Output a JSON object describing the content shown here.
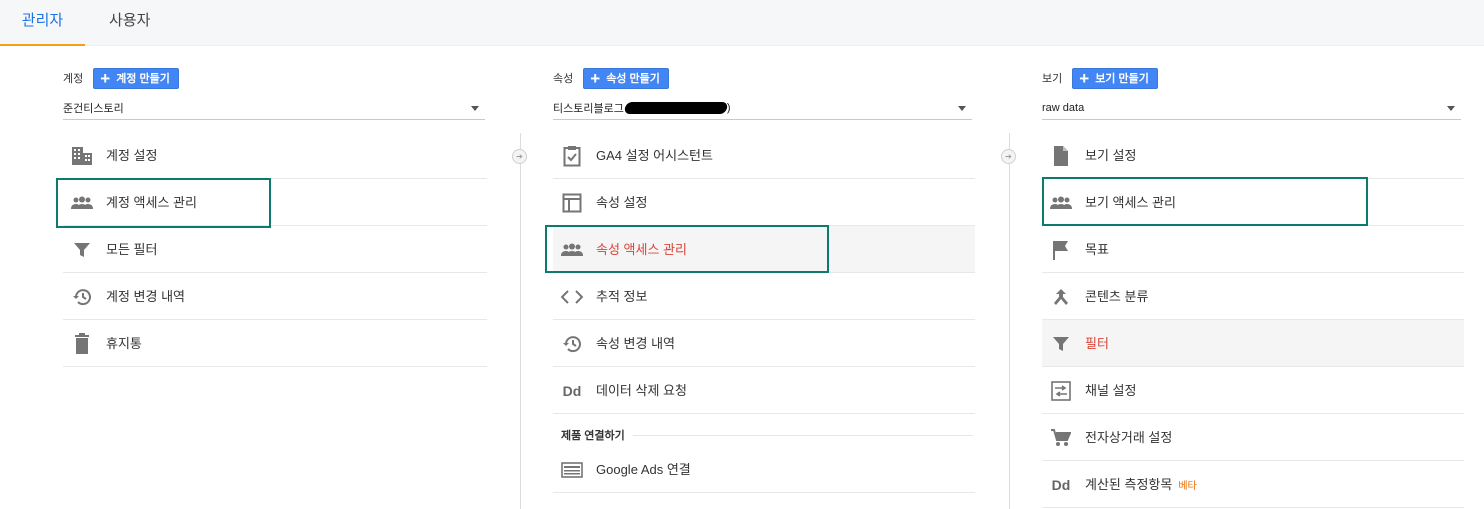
{
  "tabs": {
    "admin": "관리자",
    "user": "사용자"
  },
  "account": {
    "label": "계정",
    "create_label": "계정 만들기",
    "selected": "준건티스토리",
    "items": [
      {
        "label": "계정 설정",
        "icon": "building-icon"
      },
      {
        "label": "계정 액세스 관리",
        "icon": "people-icon"
      },
      {
        "label": "모든 필터",
        "icon": "filter-icon"
      },
      {
        "label": "계정 변경 내역",
        "icon": "history-icon"
      },
      {
        "label": "휴지통",
        "icon": "trash-icon"
      }
    ]
  },
  "property": {
    "label": "속성",
    "create_label": "속성 만들기",
    "selected": "티스토리블로그",
    "selected_suffix": ")",
    "items": [
      {
        "label": "GA4 설정 어시스턴트",
        "icon": "clipboard-check-icon"
      },
      {
        "label": "속성 설정",
        "icon": "layout-icon"
      },
      {
        "label": "속성 액세스 관리",
        "icon": "people-icon"
      },
      {
        "label": "추적 정보",
        "icon": "code-icon"
      },
      {
        "label": "속성 변경 내역",
        "icon": "history-icon"
      },
      {
        "label": "데이터 삭제 요청",
        "icon": "dd-icon"
      }
    ],
    "section_title": "제품 연결하기",
    "link_items": [
      {
        "label": "Google Ads 연결",
        "icon": "ads-icon"
      }
    ]
  },
  "view": {
    "label": "보기",
    "create_label": "보기 만들기",
    "selected": "raw data",
    "items": [
      {
        "label": "보기 설정",
        "icon": "document-icon"
      },
      {
        "label": "보기 액세스 관리",
        "icon": "people-icon"
      },
      {
        "label": "목표",
        "icon": "flag-icon"
      },
      {
        "label": "콘텐츠 분류",
        "icon": "merge-icon"
      },
      {
        "label": "필터",
        "icon": "filter-icon"
      },
      {
        "label": "채널 설정",
        "icon": "channel-icon"
      },
      {
        "label": "전자상거래 설정",
        "icon": "cart-icon"
      },
      {
        "label": "계산된 측정항목",
        "icon": "dd-icon",
        "badge": "베타"
      }
    ]
  },
  "colors": {
    "accent": "#4285f4",
    "highlight_border": "#0d7a70",
    "active_text": "#db4437",
    "tab_underline": "#f1a01c"
  }
}
